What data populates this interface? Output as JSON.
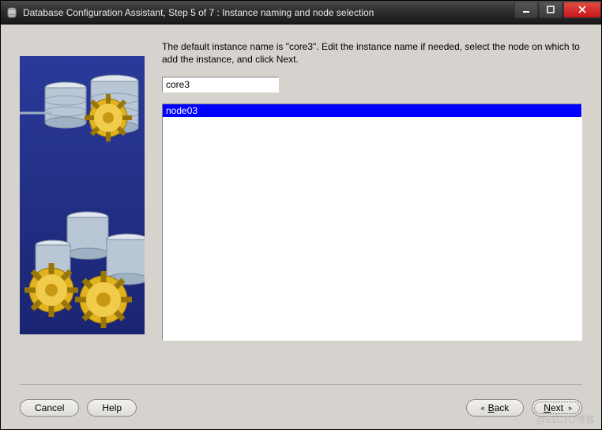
{
  "window": {
    "title": "Database Configuration Assistant, Step 5 of 7 : Instance naming and node selection"
  },
  "main": {
    "instruction": "The default instance name is \"core3\". Edit the instance name if needed, select the node on which to add the instance, and click Next.",
    "instance_value": "core3",
    "nodes": {
      "0": {
        "label": "node03"
      }
    }
  },
  "buttons": {
    "cancel": "Cancel",
    "help": "Help",
    "back_chev": "«",
    "back_u": "B",
    "back_rest": "ack",
    "next_u": "N",
    "next_rest": "ext",
    "next_chev": "»"
  },
  "watermark": "@51CTO博客"
}
